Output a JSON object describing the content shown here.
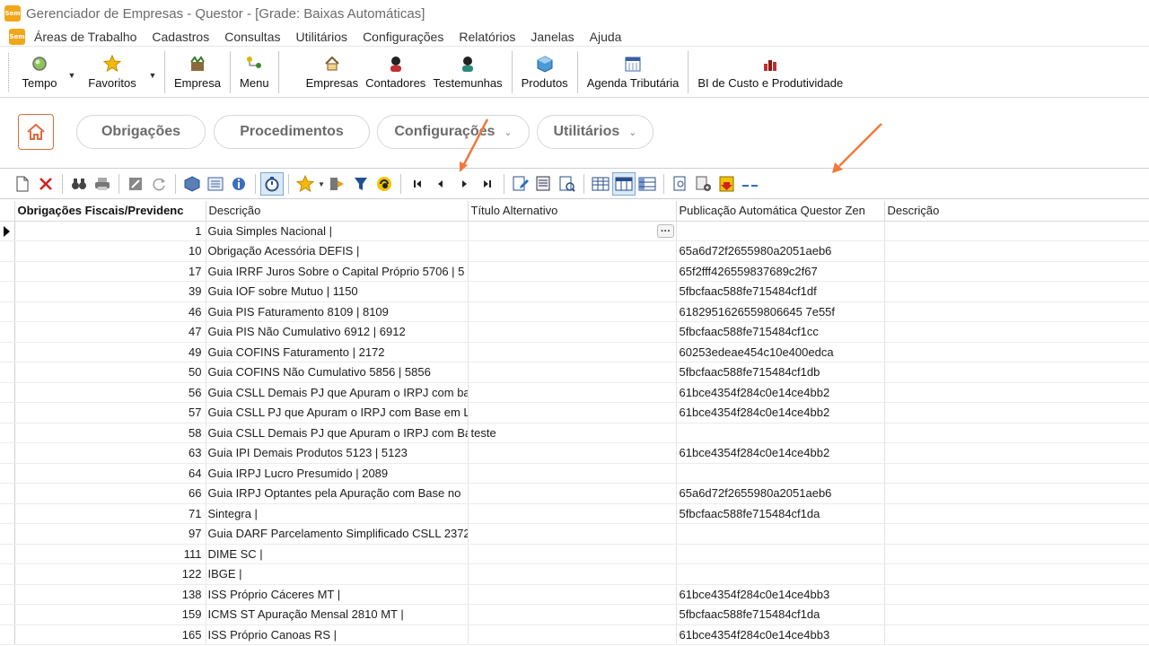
{
  "window": {
    "title": "Gerenciador de Empresas - Questor - [Grade: Baixas Automáticas]",
    "app_icon_label": "Sem"
  },
  "menu": {
    "items": [
      "Áreas de Trabalho",
      "Cadastros",
      "Consultas",
      "Utilitários",
      "Configurações",
      "Relatórios",
      "Janelas",
      "Ajuda"
    ]
  },
  "toolbar": {
    "tempo": "Tempo",
    "favoritos": "Favoritos",
    "empresa": "Empresa",
    "menu": "Menu",
    "empresas": "Empresas",
    "contadores": "Contadores",
    "testemunhas": "Testemunhas",
    "produtos": "Produtos",
    "agenda": "Agenda Tributária",
    "bi": "BI de Custo e Produtividade"
  },
  "nav": {
    "obrigacoes": "Obrigações",
    "procedimentos": "Procedimentos",
    "configuracoes": "Configurações",
    "utilitarios": "Utilitários"
  },
  "grid": {
    "columns": [
      "Obrigações Fiscais/Previdenc",
      "Descrição",
      "Título Alternativo",
      "Publicação Automática Questor Zen",
      "Descrição"
    ],
    "rows": [
      {
        "id": "1",
        "desc": "Guia Simples Nacional |",
        "alt": "",
        "pub": "",
        "desc2": ""
      },
      {
        "id": "10",
        "desc": "Obrigação Acessória DEFIS |",
        "alt": "",
        "pub": "65a6d72f2655980a2051aeb6",
        "desc2": ""
      },
      {
        "id": "17",
        "desc": "Guia IRRF Juros Sobre o Capital Próprio 5706 | 5",
        "alt": "",
        "pub": "65f2fff426559837689c2f67",
        "desc2": ""
      },
      {
        "id": "39",
        "desc": "Guia IOF sobre Mutuo | 1150",
        "alt": "",
        "pub": "5fbcfaac588fe715484cf1df",
        "desc2": ""
      },
      {
        "id": "46",
        "desc": "Guia PIS Faturamento 8109 | 8109",
        "alt": "",
        "pub": "6182951626559806645 7e55f",
        "desc2": ""
      },
      {
        "id": "47",
        "desc": "Guia PIS Não Cumulativo 6912 | 6912",
        "alt": "",
        "pub": "5fbcfaac588fe715484cf1cc",
        "desc2": ""
      },
      {
        "id": "49",
        "desc": "Guia COFINS Faturamento | 2172",
        "alt": "",
        "pub": "60253edeae454c10e400edca",
        "desc2": ""
      },
      {
        "id": "50",
        "desc": "Guia COFINS Não Cumulativo 5856 | 5856",
        "alt": "",
        "pub": "5fbcfaac588fe715484cf1db",
        "desc2": ""
      },
      {
        "id": "56",
        "desc": "Guia CSLL Demais PJ que Apuram o IRPJ com ba",
        "alt": "",
        "pub": "61bce4354f284c0e14ce4bb2",
        "desc2": ""
      },
      {
        "id": "57",
        "desc": "Guia CSLL PJ que Apuram o IRPJ com Base em Lu",
        "alt": "",
        "pub": "61bce4354f284c0e14ce4bb2",
        "desc2": ""
      },
      {
        "id": "58",
        "desc": "Guia CSLL Demais PJ que Apuram o IRPJ com Ba",
        "alt": "teste",
        "pub": "",
        "desc2": ""
      },
      {
        "id": "63",
        "desc": "Guia IPI Demais Produtos 5123 | 5123",
        "alt": "",
        "pub": "61bce4354f284c0e14ce4bb2",
        "desc2": ""
      },
      {
        "id": "64",
        "desc": "Guia IRPJ Lucro Presumido | 2089",
        "alt": "",
        "pub": "",
        "desc2": ""
      },
      {
        "id": "66",
        "desc": "Guia IRPJ Optantes pela Apuração com Base no",
        "alt": "",
        "pub": "65a6d72f2655980a2051aeb6",
        "desc2": ""
      },
      {
        "id": "71",
        "desc": "Sintegra |",
        "alt": "",
        "pub": "5fbcfaac588fe715484cf1da",
        "desc2": ""
      },
      {
        "id": "97",
        "desc": "Guia DARF Parcelamento Simplificado CSLL 2372",
        "alt": "",
        "pub": "",
        "desc2": ""
      },
      {
        "id": "111",
        "desc": "DIME SC |",
        "alt": "",
        "pub": "",
        "desc2": ""
      },
      {
        "id": "122",
        "desc": "IBGE |",
        "alt": "",
        "pub": "",
        "desc2": ""
      },
      {
        "id": "138",
        "desc": "ISS Próprio Cáceres MT |",
        "alt": "",
        "pub": "61bce4354f284c0e14ce4bb3",
        "desc2": ""
      },
      {
        "id": "159",
        "desc": "ICMS ST Apuração Mensal 2810 MT |",
        "alt": "",
        "pub": "5fbcfaac588fe715484cf1da",
        "desc2": ""
      },
      {
        "id": "165",
        "desc": "ISS Próprio Canoas RS |",
        "alt": "",
        "pub": "61bce4354f284c0e14ce4bb3",
        "desc2": ""
      }
    ]
  },
  "colors": {
    "accent_orange": "#f07a3c",
    "home_border": "#e06a3b"
  }
}
